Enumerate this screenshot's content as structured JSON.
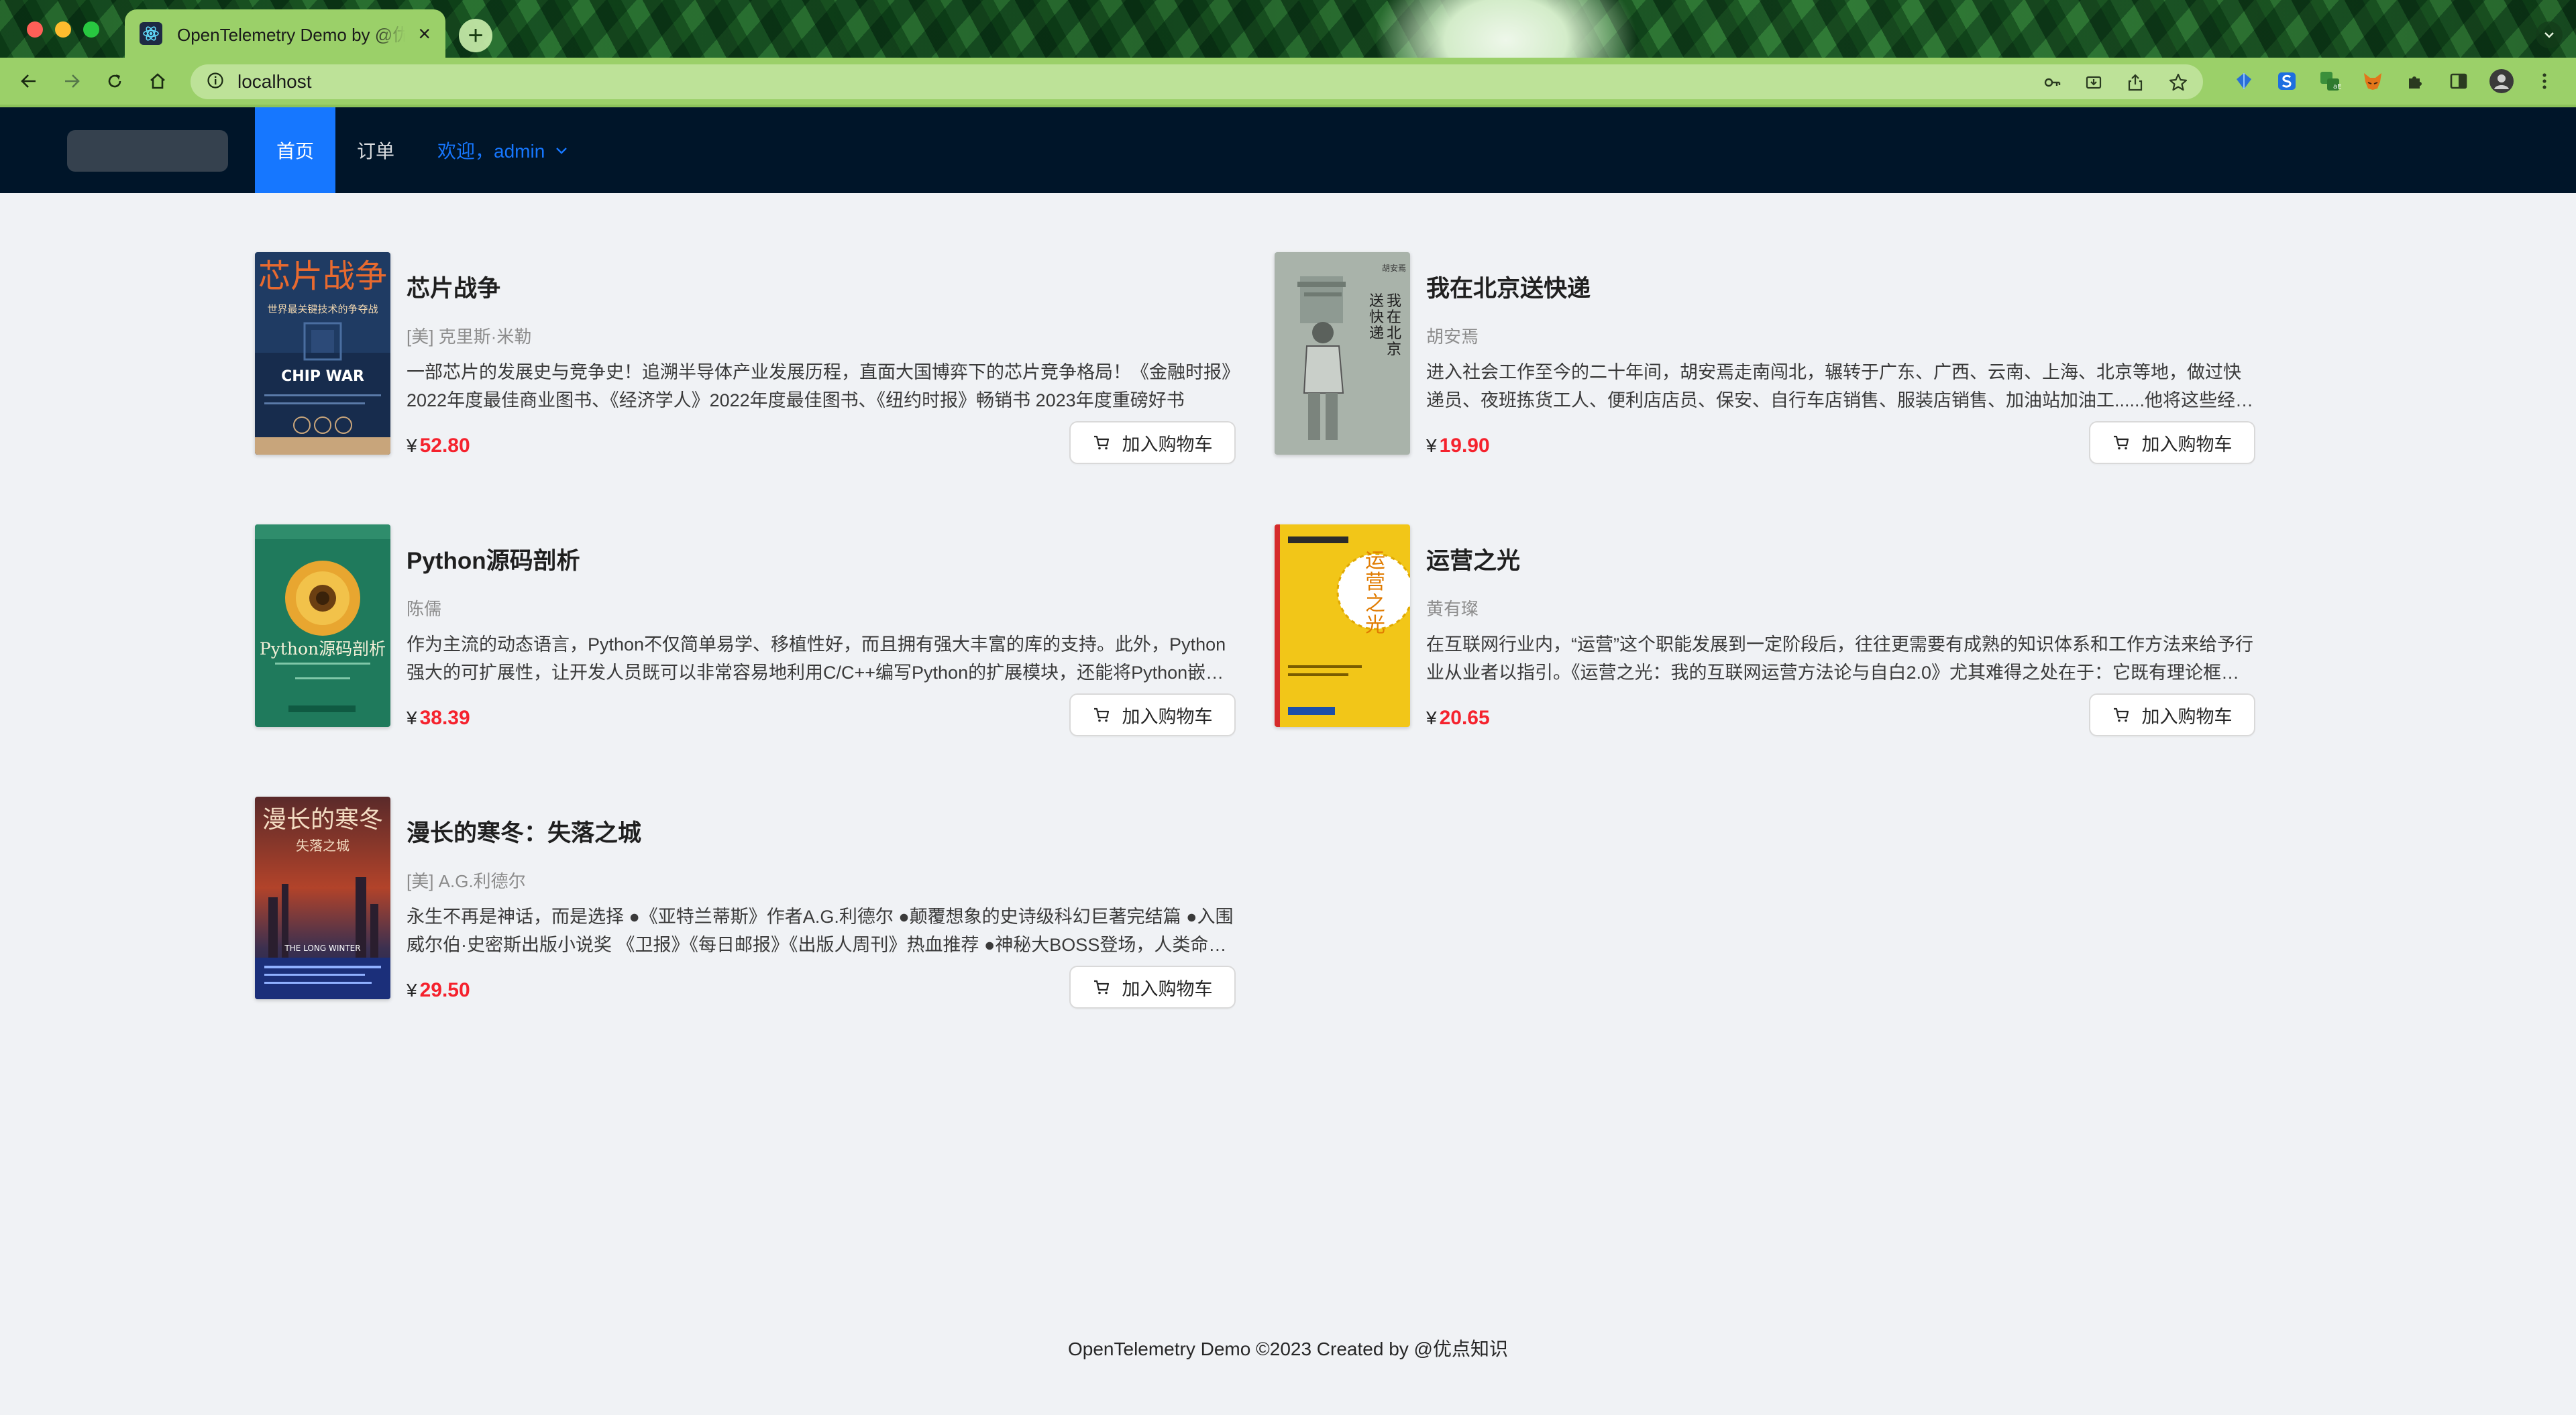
{
  "browser": {
    "tab_title": "OpenTelemetry Demo by @优点知识",
    "tab_close": "×",
    "new_tab": "+",
    "url": "localhost"
  },
  "nav": {
    "home": "首页",
    "orders": "订单",
    "user": "欢迎，admin"
  },
  "products": [
    {
      "title": "芯片战争",
      "author": "[美] 克里斯·米勒",
      "description": "一部芯片的发展史与竞争史！追溯半导体产业发展历程，直面大国博弈下的芯片竞争格局！《金融时报》2022年度最佳商业图书、《经济学人》2022年度最佳图书、《纽约时报》畅销书 2023年度重磅好书",
      "currency": "¥",
      "price": "52.80",
      "cart_label": "加入购物车",
      "cover_text": "芯片战争",
      "cover_subtitle": "世界最关键技术的争夺战",
      "cover_en": "CHIP WAR"
    },
    {
      "title": "我在北京送快递",
      "author": "胡安焉",
      "description": "进入社会工作至今的二十年间，胡安焉走南闯北，辗转于广东、广西、云南、上海、北京等地，做过快递员、夜班拣货工人、便利店店员、保安、自行车店销售、服装店销售、加油站加油工......他将这些经历写成了一本书",
      "currency": "¥",
      "price": "19.90",
      "cart_label": "加入购物车",
      "cover_text": "我在北京送快递",
      "cover_author": "胡安焉"
    },
    {
      "title": "Python源码剖析",
      "author": "陈儒",
      "description": "作为主流的动态语言，Python不仅简单易学、移植性好，而且拥有强大丰富的库的支持。此外，Python强大的可扩展性，让开发人员既可以非常容易地利用C/C++编写Python的扩展模块，还能将Python嵌入到C/C++程序中",
      "currency": "¥",
      "price": "38.39",
      "cart_label": "加入购物车",
      "cover_text": "Python源码剖析"
    },
    {
      "title": "运营之光",
      "author": "黄有璨",
      "description": "在互联网行业内，“运营”这个职能发展到一定阶段后，往往更需要有成熟的知识体系和工作方法来给予行业从业者以指引。《运营之光：我的互联网运营方法论与自白2.0》尤其难得之处在于：它既有理论框架，又有实操方法",
      "currency": "¥",
      "price": "20.65",
      "cart_label": "加入购物车",
      "cover_text": "运营之光"
    },
    {
      "title": "漫长的寒冬：失落之城",
      "author": "[美] A.G.利德尔",
      "description": "永生不再是神话，而是选择 ●《亚特兰蒂斯》作者A.G.利德尔 ●颠覆想象的史诗级科幻巨著完结篇 ●入围威尔伯·史密斯出版小说奖 《卫报》《每日邮报》《出版人周刊》热血推荐 ●神秘大BOSS登场，人类命运何去何从",
      "currency": "¥",
      "price": "29.50",
      "cart_label": "加入购物车",
      "cover_text": "漫长的寒冬",
      "cover_subtitle": "失落之城",
      "cover_en": "THE LONG WINTER"
    }
  ],
  "footer": "OpenTelemetry Demo ©2023 Created by @优点知识",
  "colors": {
    "header_bg": "#001529",
    "nav_active": "#1677ff",
    "price": "#f5222d",
    "page_bg": "#f0f2f5",
    "browser_theme": "#9bd069"
  }
}
